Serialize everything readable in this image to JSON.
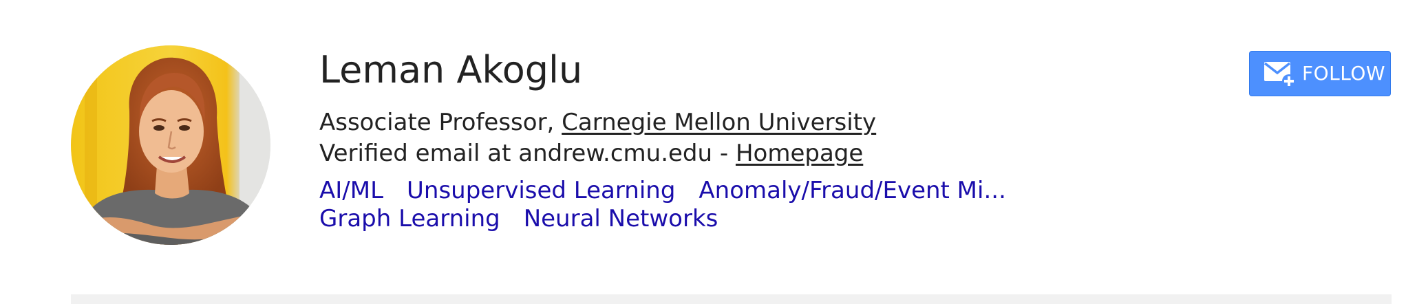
{
  "profile": {
    "name": "Leman Akoglu",
    "affiliation_prefix": "Associate Professor, ",
    "affiliation_link": "Carnegie Mellon University",
    "email_text": "Verified email at andrew.cmu.edu - ",
    "homepage_link": "Homepage",
    "interests": [
      "AI/ML",
      "Unsupervised Learning",
      "Anomaly/Fraud/Event Mi...",
      "Graph Learning",
      "Neural Networks"
    ]
  },
  "follow_button": {
    "label": "FOLLOW",
    "icon": "mail-plus-icon"
  },
  "colors": {
    "link_blue": "#1a0dab",
    "button_blue": "#4d90fe",
    "text": "#222222"
  }
}
